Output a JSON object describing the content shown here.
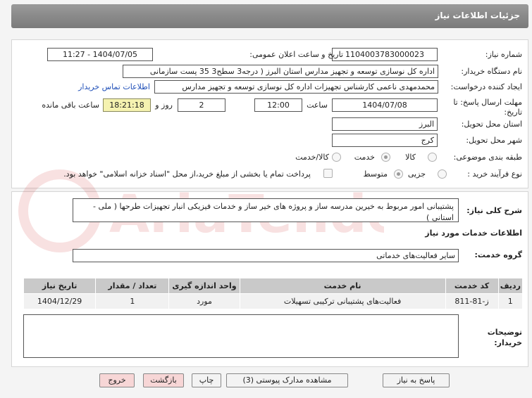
{
  "header": {
    "title": "جزئیات اطلاعات نیاز"
  },
  "form": {
    "need_number_label": "شماره نیاز:",
    "need_number": "1104003783000023",
    "announce_label": "تاریخ و ساعت اعلان عمومی:",
    "announce_value": "1404/07/05 - 11:27",
    "buyer_org_label": "نام دستگاه خریدار:",
    "buyer_org": "اداره کل نوسازی   توسعه و تجهیز مدارس استان البرز ( درجه3  سطح3  35 پست سازمانی",
    "creator_label": "ایجاد کننده درخواست:",
    "creator": "محمدمهدی ناعمی کارشناس تجهیزات اداره کل نوسازی   توسعه و تجهیز مدارس",
    "contact_link": "اطلاعات تماس خریدار",
    "deadline_label_1": "مهلت ارسال پاسخ: تا",
    "deadline_label_2": "تاریخ:",
    "deadline_date": "1404/07/08",
    "time_label": "ساعت",
    "deadline_time": "12:00",
    "days_value": "2",
    "days_label": "روز و",
    "remaining_time": "18:21:18",
    "remaining_label": "ساعت باقی مانده",
    "province_label": "استان محل تحویل:",
    "province": "البرز",
    "city_label": "شهر محل تحویل:",
    "city": "کرج",
    "category_label": "طبقه بندی موضوعی:",
    "category_options": [
      "کالا",
      "خدمت",
      "کالا/خدمت"
    ],
    "purchase_type_label": "نوع فرآیند خرید :",
    "purchase_options": [
      "جزیی",
      "متوسط"
    ],
    "payment_note": "پرداخت تمام یا بخشی از مبلغ خرید،از محل \"اسناد خزانه اسلامی\" خواهد بود."
  },
  "details": {
    "summary_label": "شرح کلی نیاز:",
    "summary": "پشتیبانی امور مربوط به خیرین مدرسه ساز و پروژه های خیر ساز و خدمات فیزیکی انبار تجهیزات طرحها ( ملی - استانی )",
    "services_heading": "اطلاعات خدمات مورد نیاز",
    "service_group_label": "گروه خدمت:",
    "service_group": "سایر فعالیت‌های خدماتی",
    "table_headers": [
      "ردیف",
      "کد خدمت",
      "نام خدمت",
      "واحد اندازه گیری",
      "تعداد / مقدار",
      "تاریخ نیاز"
    ],
    "table_rows": [
      [
        "1",
        "ز-81-811",
        "فعالیت‌های پشتیبانی ترکیبی تسهیلات",
        "مورد",
        "1",
        "1404/12/29"
      ]
    ],
    "buyer_notes_label_1": "توضیحات",
    "buyer_notes_label_2": "خریدار:",
    "buyer_notes": ""
  },
  "buttons": {
    "reply": "پاسخ به نیاز",
    "attachments": "مشاهده مدارک پیوستی (3)",
    "print": "چاپ",
    "back": "بازگشت",
    "exit": "خروج"
  },
  "watermark": {
    "text": "AriaTender.net"
  },
  "colors": {
    "header": "#8a8a8a",
    "link": "#1f4fb8",
    "timer": "#f5f2b0",
    "pink_button": "#f7d6d6"
  }
}
